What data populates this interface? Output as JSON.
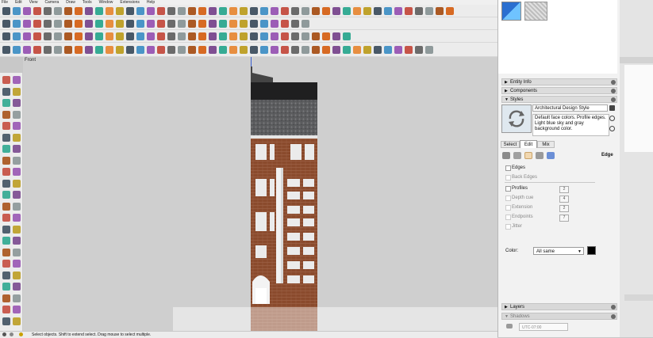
{
  "menu": [
    "File",
    "Edit",
    "View",
    "Camera",
    "Draw",
    "Tools",
    "Window",
    "Extensions",
    "Help"
  ],
  "viewport": {
    "label": "Front"
  },
  "status": {
    "text": "Select objects. Shift to extend select. Drag mouse to select multiple."
  },
  "panel": {
    "trays": {
      "entity_info": "Entity Info",
      "components": "Components",
      "styles": "Styles"
    },
    "style": {
      "name": "Architectural Design Style",
      "description": "Default face colors. Profile edges. Light blue sky and gray background color."
    },
    "tabs": [
      "Select",
      "Edit",
      "Mix"
    ],
    "section": "Edge",
    "options": {
      "edges": "Edges",
      "back_edges": "Back Edges",
      "profiles": "Profiles",
      "profiles_val": "2",
      "depth_cue": "Depth cue",
      "depth_val": "4",
      "extension": "Extension",
      "extension_val": "2",
      "endpoints": "Endpoints",
      "endpoints_val": "7",
      "jitter": "Jitter"
    },
    "color": {
      "label": "Color:",
      "value": "All same",
      "swatch": "#000000"
    },
    "bottom": {
      "layers": "Layers",
      "shadows": "Shadows",
      "tz": "UTC-07:00"
    }
  },
  "colors": {
    "accent": "#2a6fd0",
    "brick": "#8a4a2c"
  }
}
